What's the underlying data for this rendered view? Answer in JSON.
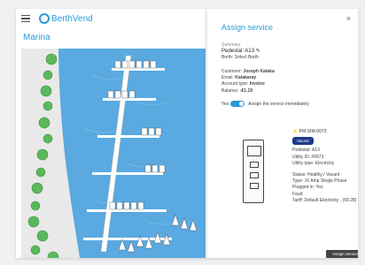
{
  "app": {
    "brand": "BerthVend",
    "page_title": "Marina"
  },
  "panel": {
    "title": "Assign service",
    "summary_label": "Summary",
    "pedestal_label": "Pedestal: A13",
    "berth_label": "Berth: Select Berth",
    "customer_label": "Customer:",
    "customer_name": "Joseph Kataka",
    "email_label": "Email:",
    "email_value": "Katakaray",
    "account_type_label": "Account type:",
    "account_type_value": "Invoice",
    "balance_label": "Balance:",
    "balance_value": "-€1.19",
    "toggle_label": "Yes",
    "toggle_text": "Assign the service immediately",
    "device_id": "PM-SIM-0073",
    "status_badge": "Vacant",
    "pedestal": "Pedestal: A13",
    "utility_id": "Utility ID: #0673",
    "utility_type": "Utility type: Electricity",
    "status_line": "Status: Healthy / Vacant",
    "type_line": "Type: 16 Amp Single Phase",
    "plugged_line": "Plugged in: Yes",
    "fault_line": "Fault:",
    "tariff_line": "Tariff: Default Electricity - (€0.28)",
    "assign_button": "Assign Service",
    "close": "×"
  },
  "colors": {
    "accent": "#2a9bd6",
    "water": "#5aa9e0",
    "tree": "#5cb85c",
    "badge": "#1d3a8a"
  },
  "icons": [
    "menu-icon",
    "logo-icon",
    "close-icon",
    "plug-icon",
    "edit-icon"
  ]
}
